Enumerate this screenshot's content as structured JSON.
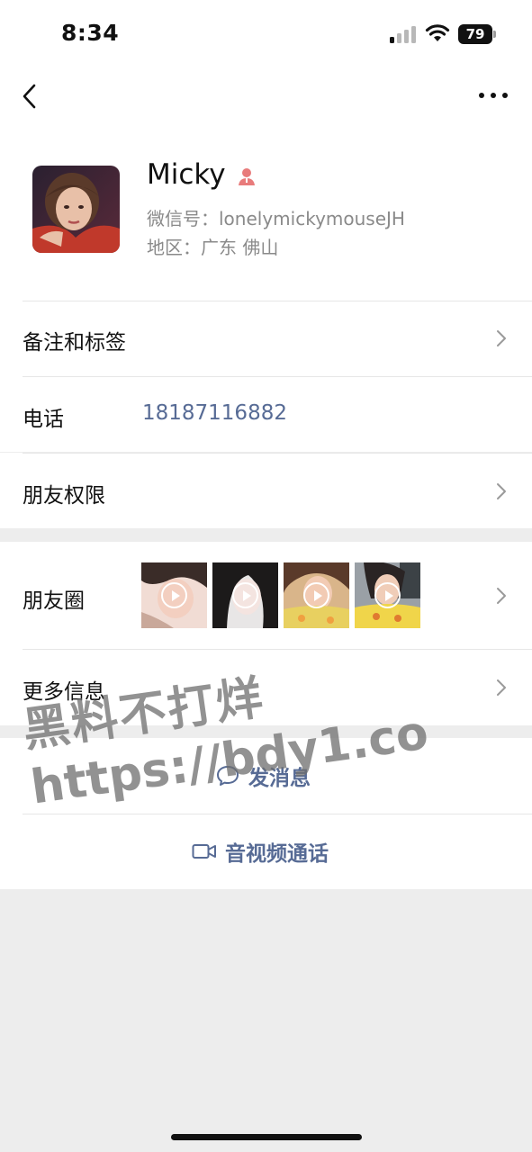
{
  "status_bar": {
    "time": "8:34",
    "battery": "79"
  },
  "profile": {
    "name": "Micky",
    "wechat_id": "微信号：lonelymickymouseJH",
    "region": "地区：广东 佛山"
  },
  "rows": {
    "remark": "备注和标签",
    "phone_label": "电话",
    "phone_value": "18187116882",
    "permissions": "朋友权限",
    "moments": "朋友圈",
    "more_info": "更多信息"
  },
  "actions": {
    "message": "发消息",
    "video_call": "音视频通话"
  },
  "watermark": {
    "line1": "黑料不打烊",
    "line2": "https://bdy1.co"
  },
  "icons": {
    "back": "back-icon",
    "more": "more-icon",
    "gender": "female-icon",
    "chevron": "chevron-right-icon",
    "message": "chat-bubble-icon",
    "video": "video-camera-icon"
  },
  "colors": {
    "link": "#576b95",
    "gender": "#e87b7b",
    "background": "#ededed"
  }
}
